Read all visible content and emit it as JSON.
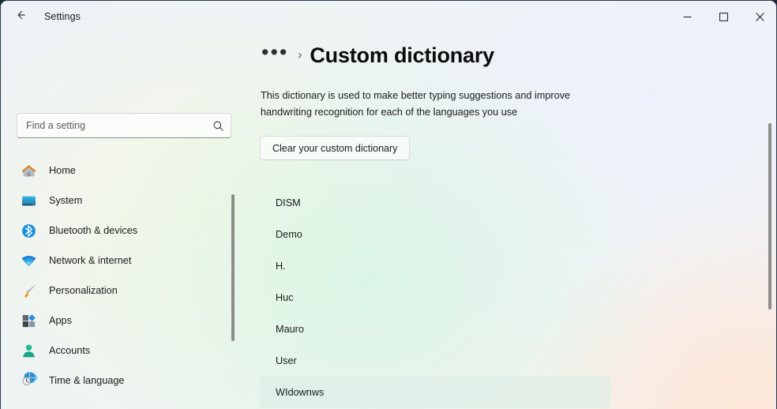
{
  "window": {
    "title": "Settings",
    "back_icon": "back-arrow-icon",
    "minimize_label": "—",
    "maximize_label": "□",
    "close_label": "✕"
  },
  "sidebar": {
    "search": {
      "placeholder": "Find a setting",
      "value": "",
      "icon": "search-icon"
    },
    "items": [
      {
        "label": "Home",
        "icon": "home-icon"
      },
      {
        "label": "System",
        "icon": "system-monitor-icon"
      },
      {
        "label": "Bluetooth & devices",
        "icon": "bluetooth-icon"
      },
      {
        "label": "Network & internet",
        "icon": "wifi-icon"
      },
      {
        "label": "Personalization",
        "icon": "paintbrush-icon"
      },
      {
        "label": "Apps",
        "icon": "apps-icon"
      },
      {
        "label": "Accounts",
        "icon": "account-person-icon"
      },
      {
        "label": "Time & language",
        "icon": "clock-globe-icon"
      }
    ]
  },
  "content": {
    "breadcrumb": {
      "overflow": "•••",
      "separator": "›"
    },
    "page_title": "Custom dictionary",
    "description": "This dictionary is used to make better typing suggestions and improve handwriting recognition for each of the languages you use",
    "clear_button": "Clear your custom dictionary",
    "words": [
      {
        "label": "DISM",
        "selected": false
      },
      {
        "label": "Demo",
        "selected": false
      },
      {
        "label": "H.",
        "selected": false
      },
      {
        "label": "Huc",
        "selected": false
      },
      {
        "label": "Mauro",
        "selected": false
      },
      {
        "label": "User",
        "selected": false
      },
      {
        "label": "WIdownws",
        "selected": true
      }
    ]
  },
  "colors": {
    "accent": "#0067c0",
    "text_primary": "#1b1b1b",
    "selected_row": "#deeee6",
    "scrollbar": "#8d8d8d",
    "close_hover": "#c42b1c"
  }
}
